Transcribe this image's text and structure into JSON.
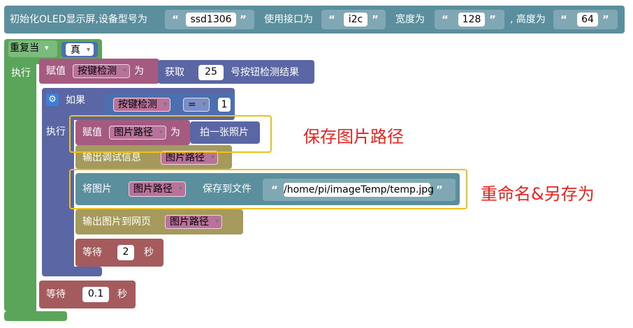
{
  "init_block": {
    "text_prefix": "初始化OLED显示屏,设备型号为",
    "model_value": "ssd1306",
    "interface_label": "使用接口为",
    "interface_value": "i2c",
    "width_label": "宽度为",
    "width_value": "128",
    "height_label": ", 高度为",
    "height_value": "64",
    "color": "#5b8f9e"
  },
  "loop_block": {
    "label": "重复当",
    "condition": "真",
    "exec_label": "执行",
    "color": "#5ba55b"
  },
  "assign_block": {
    "label": "赋值",
    "variable": "按键检测",
    "as_label": "为",
    "get_label": "获取",
    "button_number": "25",
    "get_suffix": "号按钮检测结果",
    "color": "#a55b80"
  },
  "if_block": {
    "label": "如果",
    "variable": "按键检测",
    "operator": "=",
    "compare_value": "1",
    "exec_label": "执行",
    "color": "#5b67a5"
  },
  "assign_photo": {
    "label": "赋值",
    "variable": "图片路径",
    "as_label": "为",
    "action_label": "拍一张照片"
  },
  "debug_block": {
    "label": "输出调试信息",
    "variable": "图片路径",
    "color": "#a59a5b"
  },
  "save_block": {
    "label": "将图片",
    "variable": "图片路径",
    "save_label": "保存到文件",
    "path_value": "/home/pi/imageTemp/temp.jpg",
    "color": "#5b8f9e"
  },
  "web_block": {
    "label": "输出图片到网页",
    "variable": "图片路径"
  },
  "wait_inner": {
    "label": "等待",
    "value": "2",
    "unit": "秒"
  },
  "wait_outer": {
    "label": "等待",
    "value": "0.1",
    "unit": "秒"
  },
  "annotations": {
    "save_photo_path": "保存图片路径",
    "rename_save_as": "重命名&另存为",
    "highlight_color": "#f2c01a",
    "text_color": "#e8231f"
  },
  "quote_open": "“",
  "quote_close": "”",
  "caret": "▾",
  "gear_icon": "gear-icon"
}
